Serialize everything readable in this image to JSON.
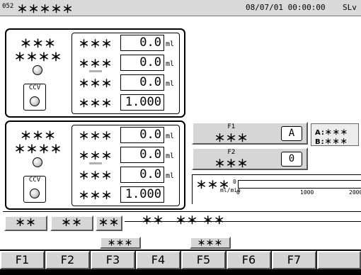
{
  "header": {
    "screen_no": "052",
    "title": "＊＊＊＊＊",
    "datetime": "08/07/01 00:00:00",
    "level": "SLv"
  },
  "pump1": {
    "title_line1": "＊＊＊",
    "title_line2": "＊＊＊＊",
    "ccv_label": "CCV",
    "rows": [
      {
        "label": "＊＊＊",
        "value": "0.0",
        "unit": "ml"
      },
      {
        "label": "＊＊＊",
        "value": "0.0",
        "unit": "ml"
      },
      {
        "label": "＊＊＊",
        "value": "0.0",
        "unit": "ml"
      },
      {
        "label": "＊＊＊",
        "value": "1.000",
        "unit": ""
      }
    ]
  },
  "pump2": {
    "title_line1": "＊＊＊",
    "title_line2": "＊＊＊＊",
    "ccv_label": "CCV",
    "rows": [
      {
        "label": "＊＊＊",
        "value": "0.0",
        "unit": "ml"
      },
      {
        "label": "＊＊＊",
        "value": "0.0",
        "unit": "ml"
      },
      {
        "label": "＊＊＊",
        "value": "0.0",
        "unit": "ml"
      },
      {
        "label": "＊＊＊",
        "value": "1.000",
        "unit": ""
      }
    ]
  },
  "selectors": {
    "f1": {
      "key": "F1",
      "label": "＊＊＊",
      "value": "A"
    },
    "f2": {
      "key": "F2",
      "label": "＊＊＊",
      "value": "0"
    },
    "legend_a": "A:＊＊＊",
    "legend_b": "B:＊＊＊"
  },
  "flow": {
    "label": "＊＊＊",
    "unit": "ml/min",
    "value": "0",
    "scale_labels": [
      "0",
      "1000",
      "2000"
    ],
    "level_fraction": 0.0
  },
  "bottom_buttons": [
    "＊＊",
    "＊＊",
    "＊＊"
  ],
  "message": "＊＊　＊＊ ＊＊",
  "fkey_labels": {
    "f3": "＊＊＊",
    "f5": "＊＊＊"
  },
  "fkeys": [
    "F1",
    "F2",
    "F3",
    "F4",
    "F5",
    "F6",
    "F7",
    ""
  ]
}
